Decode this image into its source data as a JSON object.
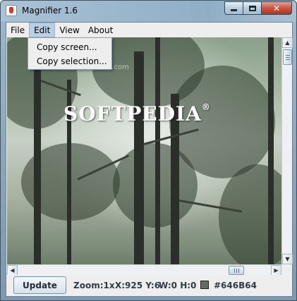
{
  "window": {
    "title": "Magnifier 1.6",
    "minimize_glyph": "",
    "maximize_glyph": "",
    "close_glyph": "✕"
  },
  "menubar": {
    "items": [
      {
        "label": "File"
      },
      {
        "label": "Edit"
      },
      {
        "label": "View"
      },
      {
        "label": "About"
      }
    ],
    "active_item": "Edit"
  },
  "edit_menu": {
    "items": [
      {
        "label": "Copy screen..."
      },
      {
        "label": "Copy selection..."
      }
    ]
  },
  "viewport": {
    "logo_text": "SOFTPEDIA",
    "logo_mark": "®",
    "watermark_url": "www.softpedia.com"
  },
  "scrollbars": {
    "up_arrow": "▲",
    "down_arrow": "▼",
    "left_arrow": "◀",
    "right_arrow": "▶"
  },
  "statusbar": {
    "update_label": "Update",
    "zoom": "Zoom:1x",
    "coords": "X:925 Y:6",
    "size": "W:0 H:0",
    "color_hex": "#646B64",
    "color_swatch": "#646B64"
  }
}
